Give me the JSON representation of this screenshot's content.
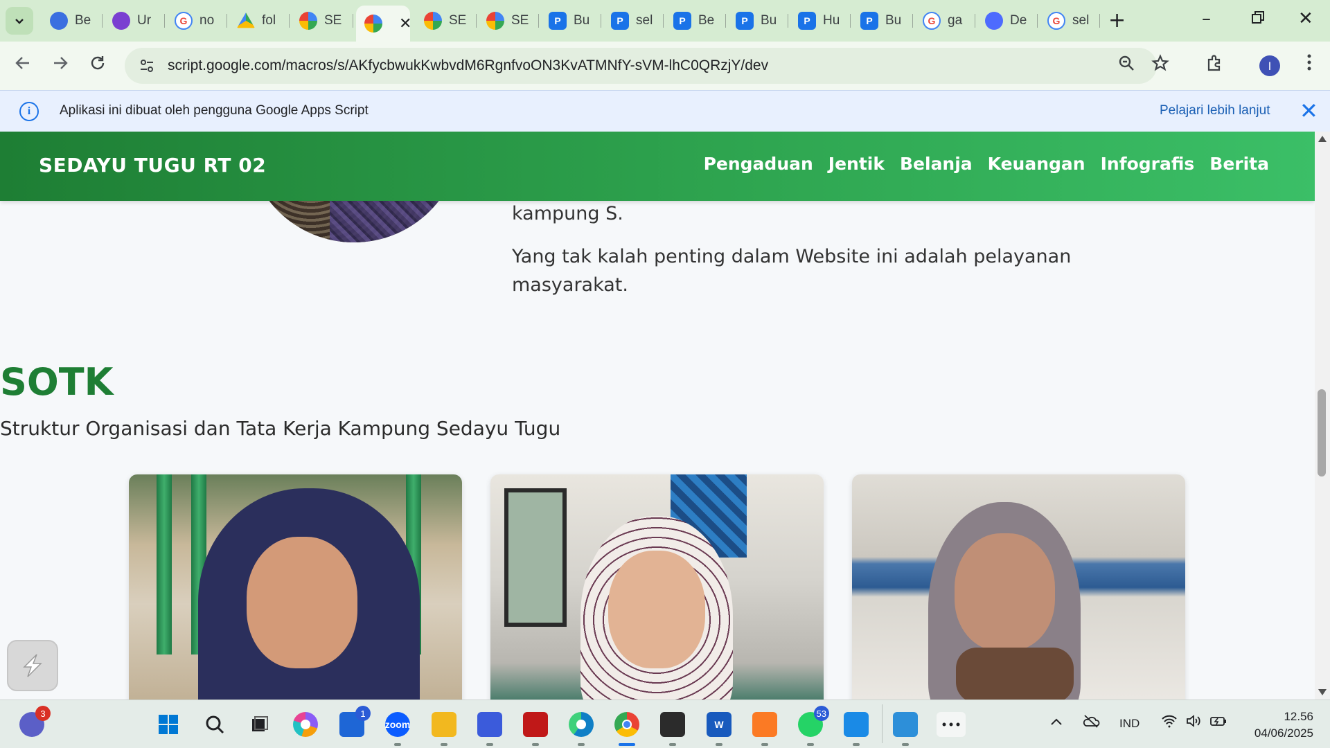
{
  "browser": {
    "tabs": [
      {
        "label": "Be",
        "icon": "copilot-icon",
        "color": "#3b6fe0"
      },
      {
        "label": "Ur",
        "icon": "chat-icon",
        "color": "#7a3fd1"
      },
      {
        "label": "no",
        "icon": "google-icon",
        "color": "#ffffff"
      },
      {
        "label": "fol",
        "icon": "drive-icon",
        "color": "#34a853"
      },
      {
        "label": "SE",
        "icon": "apps-script-icon",
        "color": "#f4b400"
      },
      {
        "label": "",
        "icon": "apps-script-icon",
        "color": "#f4b400",
        "active": true
      },
      {
        "label": "SE",
        "icon": "apps-script-icon",
        "color": "#f4b400"
      },
      {
        "label": "SE",
        "icon": "apps-script-icon",
        "color": "#f4b400"
      },
      {
        "label": "Bu",
        "icon": "p-icon",
        "color": "#1a73e8"
      },
      {
        "label": "sel",
        "icon": "p-icon",
        "color": "#1a73e8"
      },
      {
        "label": "Be",
        "icon": "p-icon",
        "color": "#1a73e8"
      },
      {
        "label": "Bu",
        "icon": "p-icon",
        "color": "#1a73e8"
      },
      {
        "label": "Hu",
        "icon": "p-icon",
        "color": "#1a73e8"
      },
      {
        "label": "Bu",
        "icon": "p-icon",
        "color": "#1a73e8"
      },
      {
        "label": "ga",
        "icon": "google-icon",
        "color": "#ffffff"
      },
      {
        "label": "De",
        "icon": "deepseek-icon",
        "color": "#4d6bfe"
      },
      {
        "label": "sel",
        "icon": "google-icon",
        "color": "#ffffff"
      }
    ],
    "url": "script.google.com/macros/s/AKfycbwukKwbvdM6RgnfvoON3KvATMNfY-sVM-lhC0QRzjY/dev",
    "profile_initial": "I",
    "infobar": {
      "message": "Aplikasi ini dibuat oleh pengguna Google Apps Script",
      "link": "Pelajari lebih lanjut"
    }
  },
  "site": {
    "brand": "SEDAYU TUGU RT 02",
    "menu": [
      "Pengaduan",
      "Jentik",
      "Belanja",
      "Keuangan",
      "Infografis",
      "Berita"
    ],
    "about": {
      "line1": "kampung S.",
      "line2": "Yang tak kalah penting dalam Website ini adalah pelayanan masyarakat."
    },
    "sotk": {
      "title": "SOTK",
      "subtitle": "Struktur Organisasi dan Tata Kerja Kampung Sedayu Tugu"
    },
    "colors": {
      "primary": "#1e7e34",
      "accent": "#2ea44f"
    }
  },
  "taskbar": {
    "icons": [
      {
        "name": "teams-icon",
        "badge": "3",
        "badge_color": "red"
      },
      {
        "name": "windows-start-icon"
      },
      {
        "name": "search-icon"
      },
      {
        "name": "task-view-icon"
      },
      {
        "name": "copilot-icon"
      },
      {
        "name": "store-icon",
        "badge": "1"
      },
      {
        "name": "zoom-icon",
        "label": "zoom"
      },
      {
        "name": "file-explorer-icon"
      },
      {
        "name": "pen-app-icon"
      },
      {
        "name": "mcafee-icon"
      },
      {
        "name": "edge-icon"
      },
      {
        "name": "chrome-icon",
        "active": true
      },
      {
        "name": "terminal-icon"
      },
      {
        "name": "word-icon",
        "label": "W"
      },
      {
        "name": "xampp-icon"
      },
      {
        "name": "whatsapp-icon",
        "badge": "53"
      },
      {
        "name": "vscode-icon"
      },
      {
        "name": "photos-icon"
      },
      {
        "name": "more-icon"
      }
    ],
    "tray": {
      "language": "IND",
      "time": "12.56",
      "date": "04/06/2025"
    }
  }
}
